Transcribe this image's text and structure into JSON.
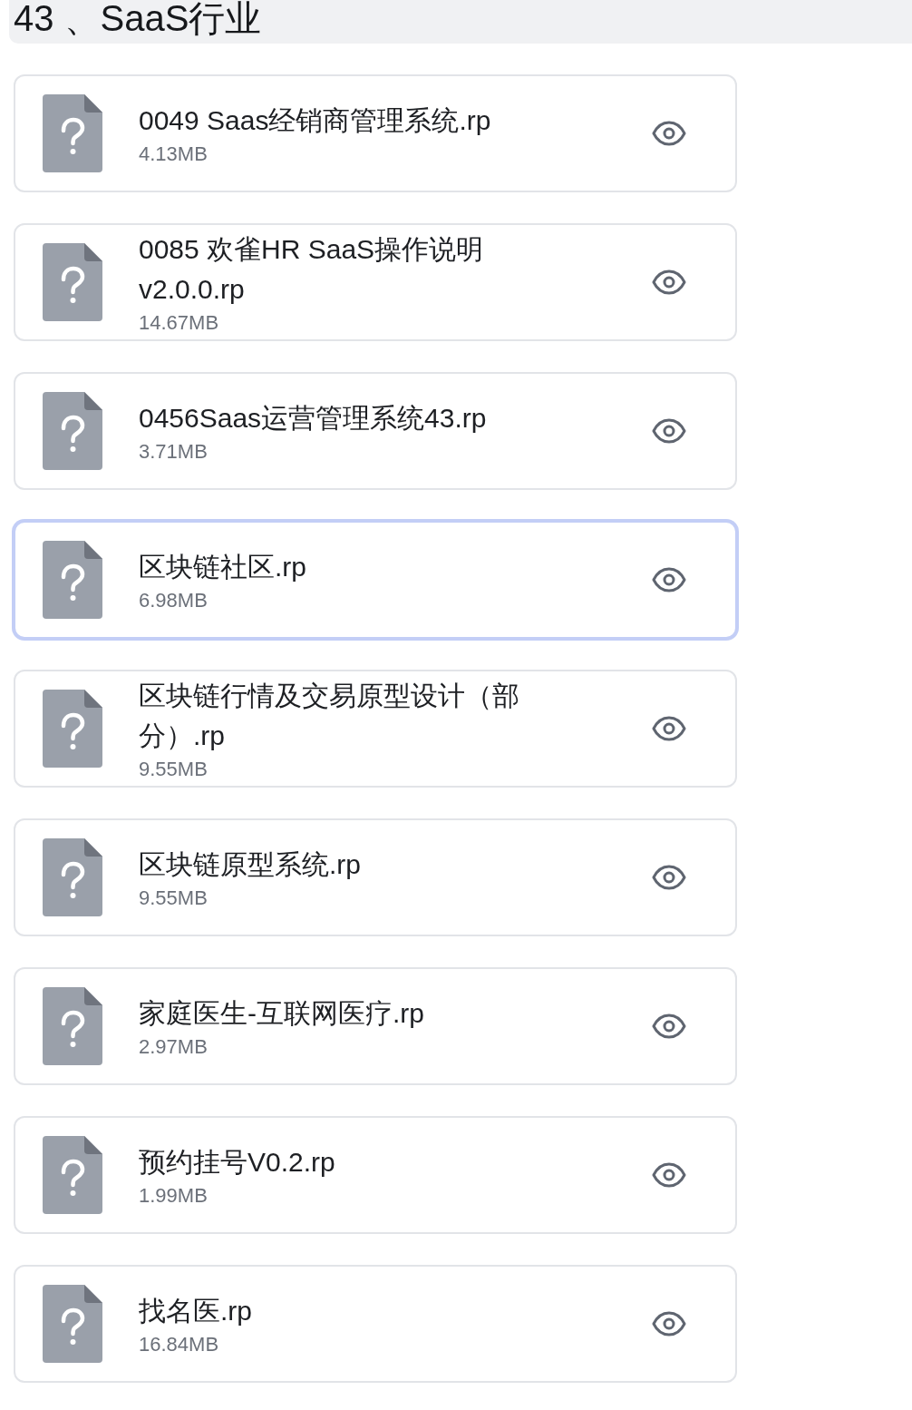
{
  "header": {
    "title": "43 、SaaS行业"
  },
  "files": [
    {
      "name": "0049 Saas经销商管理系统.rp",
      "size": "4.13MB",
      "selected": false
    },
    {
      "name": "0085 欢雀HR SaaS操作说明 v2.0.0.rp",
      "size": "14.67MB",
      "selected": false
    },
    {
      "name": "0456Saas运营管理系统43.rp",
      "size": "3.71MB",
      "selected": false
    },
    {
      "name": "区块链社区.rp",
      "size": "6.98MB",
      "selected": true
    },
    {
      "name": "区块链行情及交易原型设计（部分）.rp",
      "size": "9.55MB",
      "selected": false
    },
    {
      "name": "区块链原型系统.rp",
      "size": "9.55MB",
      "selected": false
    },
    {
      "name": "家庭医生-互联网医疗.rp",
      "size": "2.97MB",
      "selected": false
    },
    {
      "name": "预约挂号V0.2.rp",
      "size": "1.99MB",
      "selected": false
    },
    {
      "name": "找名医.rp",
      "size": "16.84MB",
      "selected": false
    }
  ]
}
